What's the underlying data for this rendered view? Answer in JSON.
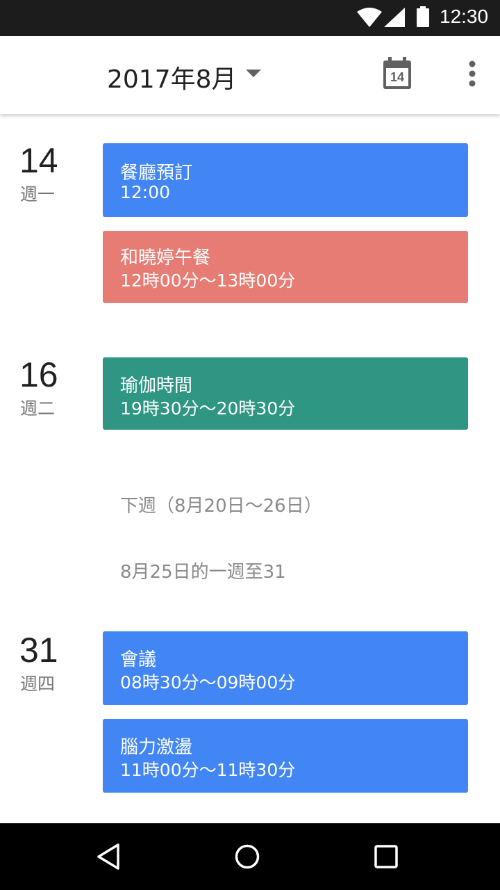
{
  "status_bar": {
    "time": "12:30",
    "icons": [
      "wifi-icon",
      "signal-icon",
      "battery-icon"
    ]
  },
  "app_bar": {
    "title": "2017年8月",
    "today_icon_day": "14",
    "icons": [
      "dropdown-icon",
      "today-calendar-icon",
      "more-vert-icon"
    ]
  },
  "colors": {
    "blue": "#4285f4",
    "red": "#e67c73",
    "teal": "#2e9683"
  },
  "days": [
    {
      "day": "14",
      "weekday": "週一",
      "events": [
        {
          "title": "餐廳預訂",
          "time": "12:00",
          "color": "#4285f4"
        },
        {
          "title": "和曉婷午餐",
          "time": "12時00分～13時00分",
          "color": "#e67c73"
        }
      ]
    },
    {
      "day": "16",
      "weekday": "週二",
      "events": [
        {
          "title": "瑜伽時間",
          "time": "19時30分～20時30分",
          "color": "#2e9683"
        }
      ]
    },
    {
      "day": "31",
      "weekday": "週四",
      "events": [
        {
          "title": "會議",
          "time": "08時30分～09時00分",
          "color": "#4285f4"
        },
        {
          "title": "腦力激盪",
          "time": "11時00分～11時30分",
          "color": "#4285f4"
        }
      ]
    }
  ],
  "week_labels": {
    "next_week": "下週（8月20日～26日）",
    "week_of": "8月25日的一週至31"
  },
  "nav_bar": {
    "icons": [
      "back-icon",
      "home-icon",
      "recents-icon"
    ]
  }
}
